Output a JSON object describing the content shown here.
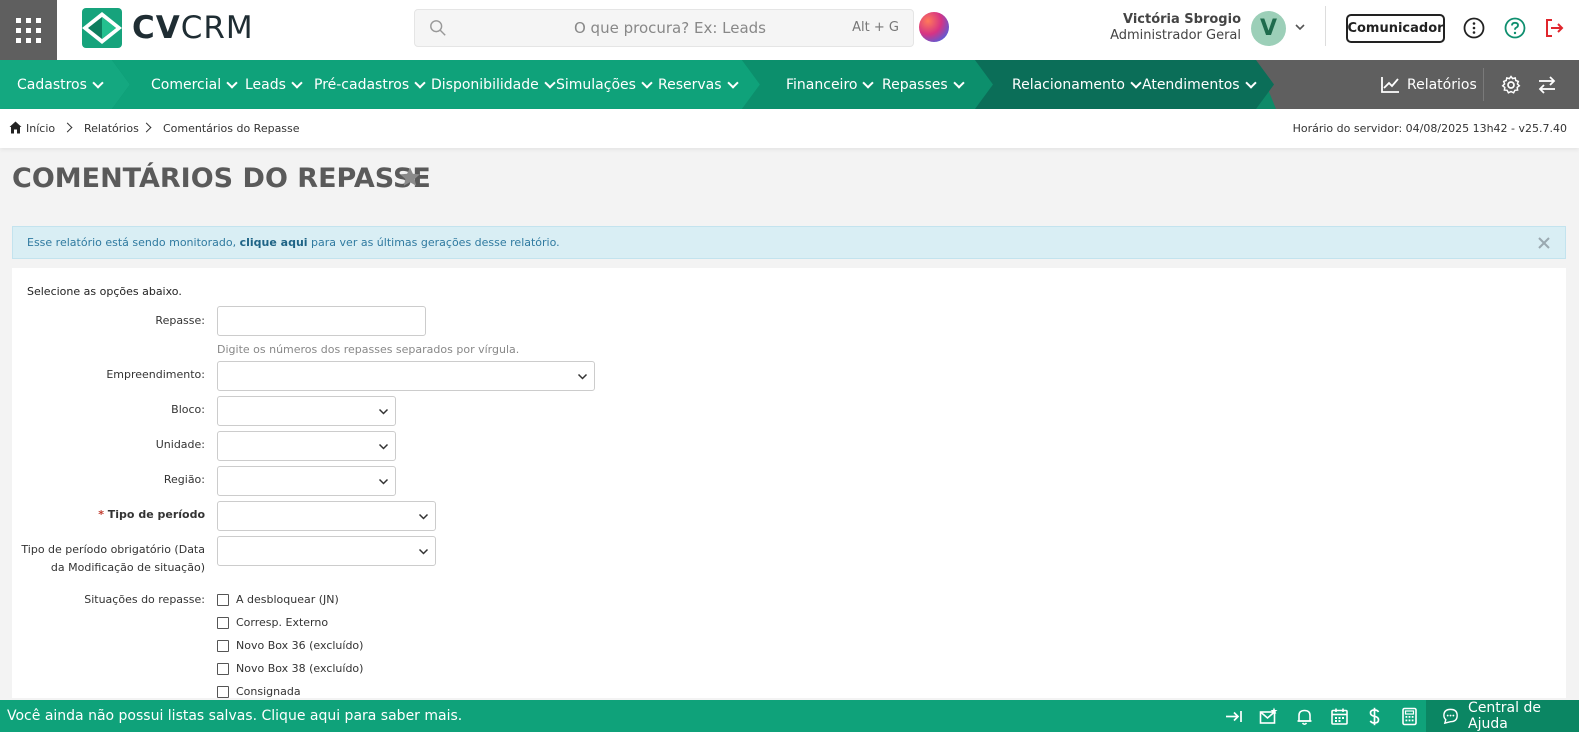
{
  "header": {
    "brand": {
      "bold": "CV",
      "light": "CRM"
    },
    "search": {
      "placeholder": "O que procura? Ex: Leads",
      "shortcut": "Alt + G"
    },
    "user": {
      "name": "Victória Sbrogio",
      "role": "Administrador Geral",
      "initial": "V"
    },
    "comunicador_label": "Comunicador"
  },
  "nav": {
    "items": [
      {
        "label": "Cadastros"
      },
      {
        "label": "Comercial"
      },
      {
        "label": "Leads"
      },
      {
        "label": "Pré-cadastros"
      },
      {
        "label": "Disponibilidade"
      },
      {
        "label": "Simulações"
      },
      {
        "label": "Reservas"
      },
      {
        "label": "Financeiro"
      },
      {
        "label": "Repasses"
      },
      {
        "label": "Relacionamento"
      },
      {
        "label": "Atendimentos"
      }
    ],
    "reports_label": "Relatórios"
  },
  "breadcrumb": {
    "items": [
      "Início",
      "Relatórios",
      "Comentários do Repasse"
    ],
    "server_time": "Horário do servidor: 04/08/2025 13h42 - v25.7.40"
  },
  "page": {
    "title": "COMENTÁRIOS DO REPASSE"
  },
  "alert": {
    "prefix": "Esse relatório está sendo monitorado, ",
    "link": "clique aqui",
    "suffix": " para ver as últimas gerações desse relatório."
  },
  "form": {
    "intro": "Selecione as opções abaixo.",
    "repasse_label": "Repasse:",
    "repasse_hint": "Digite os números dos repasses separados por vírgula.",
    "empreendimento_label": "Empreendimento:",
    "bloco_label": "Bloco:",
    "unidade_label": "Unidade:",
    "regiao_label": "Região:",
    "tipo_periodo_asterisk": "* ",
    "tipo_periodo_label": "Tipo de período",
    "tipo_periodo_obrig_label_1": "Tipo de período obrigatório (Data",
    "tipo_periodo_obrig_label_2": "da Modificação de situação)",
    "situacoes_label": "Situações do repasse:",
    "situacoes": [
      "A desbloquear (JN)",
      "Corresp. Externo",
      "Novo Box 36 (excluído)",
      "Novo Box 38 (excluído)",
      "Consignada"
    ]
  },
  "footer": {
    "message": "Você ainda não possui listas salvas. Clique aqui para saber mais.",
    "help_label": "Central de Ajuda"
  },
  "colors": {
    "nav_green": "#0fa27a",
    "nav_dark": "#0b6e58",
    "footer": "#0fa27a",
    "logout": "#e0262d",
    "help_icon": "#0f8f6f"
  }
}
